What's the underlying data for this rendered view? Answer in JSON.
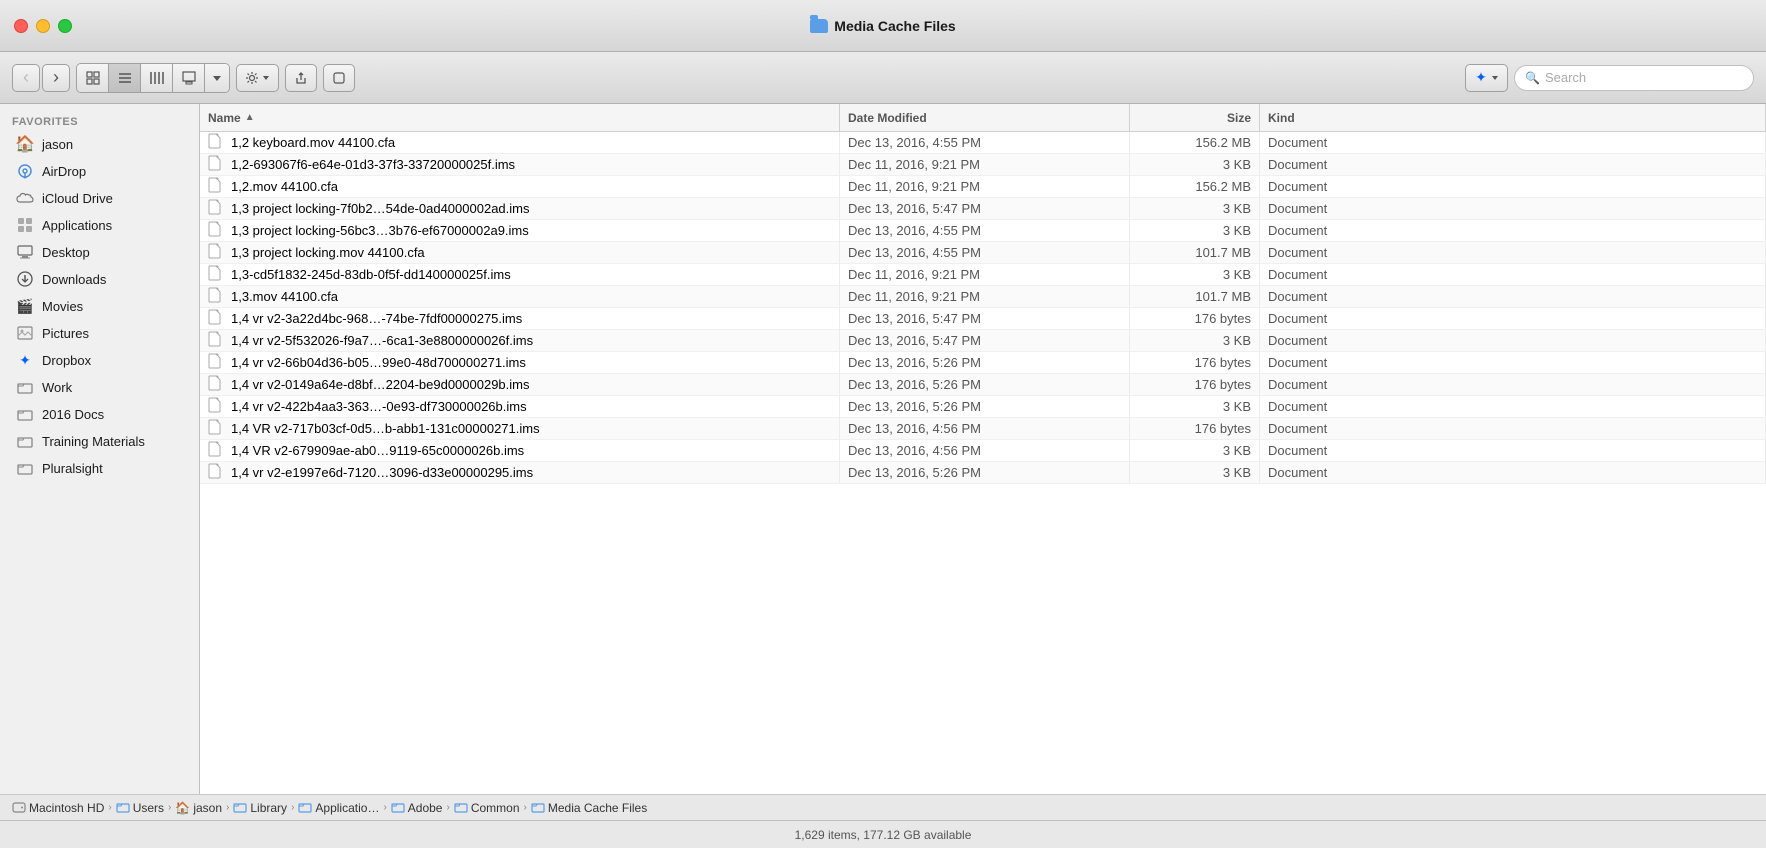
{
  "titleBar": {
    "title": "Media Cache Files",
    "folderIcon": true
  },
  "toolbar": {
    "searchPlaceholder": "Search",
    "viewModes": [
      "grid",
      "list",
      "columns",
      "cover"
    ],
    "activeView": "list",
    "gearLabel": "⚙",
    "shareLabel": "⬆",
    "tagLabel": "⬛",
    "dropboxLabel": "Dropbox"
  },
  "sidebar": {
    "sectionLabel": "Favorites",
    "items": [
      {
        "id": "jason",
        "label": "jason",
        "icon": "🏠"
      },
      {
        "id": "airdrop",
        "label": "AirDrop",
        "icon": "📡"
      },
      {
        "id": "icloud",
        "label": "iCloud Drive",
        "icon": "☁"
      },
      {
        "id": "applications",
        "label": "Applications",
        "icon": "🅰"
      },
      {
        "id": "desktop",
        "label": "Desktop",
        "icon": "🖥"
      },
      {
        "id": "downloads",
        "label": "Downloads",
        "icon": "⬇"
      },
      {
        "id": "movies",
        "label": "Movies",
        "icon": "🎬"
      },
      {
        "id": "pictures",
        "label": "Pictures",
        "icon": "🖼"
      },
      {
        "id": "dropbox",
        "label": "Dropbox",
        "icon": "📦"
      },
      {
        "id": "work",
        "label": "Work",
        "icon": "📁"
      },
      {
        "id": "2016docs",
        "label": "2016 Docs",
        "icon": "📁"
      },
      {
        "id": "training",
        "label": "Training Materials",
        "icon": "📁"
      },
      {
        "id": "pluralsight",
        "label": "Pluralsight",
        "icon": "📁"
      }
    ]
  },
  "fileList": {
    "columns": [
      {
        "id": "name",
        "label": "Name",
        "sortActive": true,
        "sortDir": "asc"
      },
      {
        "id": "date",
        "label": "Date Modified",
        "sortActive": false
      },
      {
        "id": "size",
        "label": "Size",
        "sortActive": false
      },
      {
        "id": "kind",
        "label": "Kind",
        "sortActive": false
      }
    ],
    "rows": [
      {
        "name": "1,2 keyboard.mov 44100.cfa",
        "date": "Dec 13, 2016, 4:55 PM",
        "size": "156.2 MB",
        "kind": "Document"
      },
      {
        "name": "1,2-693067f6-e64e-01d3-37f3-33720000025f.ims",
        "date": "Dec 11, 2016, 9:21 PM",
        "size": "3 KB",
        "kind": "Document"
      },
      {
        "name": "1,2.mov 44100.cfa",
        "date": "Dec 11, 2016, 9:21 PM",
        "size": "156.2 MB",
        "kind": "Document"
      },
      {
        "name": "1,3 project locking-7f0b2…54de-0ad4000002ad.ims",
        "date": "Dec 13, 2016, 5:47 PM",
        "size": "3 KB",
        "kind": "Document"
      },
      {
        "name": "1,3 project locking-56bc3…3b76-ef67000002a9.ims",
        "date": "Dec 13, 2016, 4:55 PM",
        "size": "3 KB",
        "kind": "Document"
      },
      {
        "name": "1,3 project locking.mov 44100.cfa",
        "date": "Dec 13, 2016, 4:55 PM",
        "size": "101.7 MB",
        "kind": "Document"
      },
      {
        "name": "1,3-cd5f1832-245d-83db-0f5f-dd140000025f.ims",
        "date": "Dec 11, 2016, 9:21 PM",
        "size": "3 KB",
        "kind": "Document"
      },
      {
        "name": "1,3.mov 44100.cfa",
        "date": "Dec 11, 2016, 9:21 PM",
        "size": "101.7 MB",
        "kind": "Document"
      },
      {
        "name": "1,4 vr v2-3a22d4bc-968…-74be-7fdf00000275.ims",
        "date": "Dec 13, 2016, 5:47 PM",
        "size": "176 bytes",
        "kind": "Document"
      },
      {
        "name": "1,4 vr v2-5f532026-f9a7…-6ca1-3e8800000026f.ims",
        "date": "Dec 13, 2016, 5:47 PM",
        "size": "3 KB",
        "kind": "Document"
      },
      {
        "name": "1,4 vr v2-66b04d36-b05…99e0-48d700000271.ims",
        "date": "Dec 13, 2016, 5:26 PM",
        "size": "176 bytes",
        "kind": "Document"
      },
      {
        "name": "1,4 vr v2-0149a64e-d8bf…2204-be9d0000029b.ims",
        "date": "Dec 13, 2016, 5:26 PM",
        "size": "176 bytes",
        "kind": "Document"
      },
      {
        "name": "1,4 vr v2-422b4aa3-363…-0e93-df730000026b.ims",
        "date": "Dec 13, 2016, 5:26 PM",
        "size": "3 KB",
        "kind": "Document"
      },
      {
        "name": "1,4 VR v2-717b03cf-0d5…b-abb1-131c00000271.ims",
        "date": "Dec 13, 2016, 4:56 PM",
        "size": "176 bytes",
        "kind": "Document"
      },
      {
        "name": "1,4 VR v2-679909ae-ab0…9119-65c0000026b.ims",
        "date": "Dec 13, 2016, 4:56 PM",
        "size": "3 KB",
        "kind": "Document"
      },
      {
        "name": "1,4 vr v2-e1997e6d-7120…3096-d33e00000295.ims",
        "date": "Dec 13, 2016, 5:26 PM",
        "size": "3 KB",
        "kind": "Document"
      }
    ]
  },
  "pathBar": {
    "items": [
      {
        "id": "macintosh-hd",
        "label": "Macintosh HD",
        "type": "hd"
      },
      {
        "id": "users",
        "label": "Users",
        "type": "folder"
      },
      {
        "id": "jason",
        "label": "jason",
        "type": "home"
      },
      {
        "id": "library",
        "label": "Library",
        "type": "folder"
      },
      {
        "id": "applicatio",
        "label": "Applicatio…",
        "type": "folder"
      },
      {
        "id": "adobe",
        "label": "Adobe",
        "type": "folder"
      },
      {
        "id": "common",
        "label": "Common",
        "type": "folder"
      },
      {
        "id": "media-cache-files",
        "label": "Media Cache Files",
        "type": "folder"
      }
    ]
  },
  "statusBar": {
    "text": "1,629 items, 177.12 GB available"
  }
}
